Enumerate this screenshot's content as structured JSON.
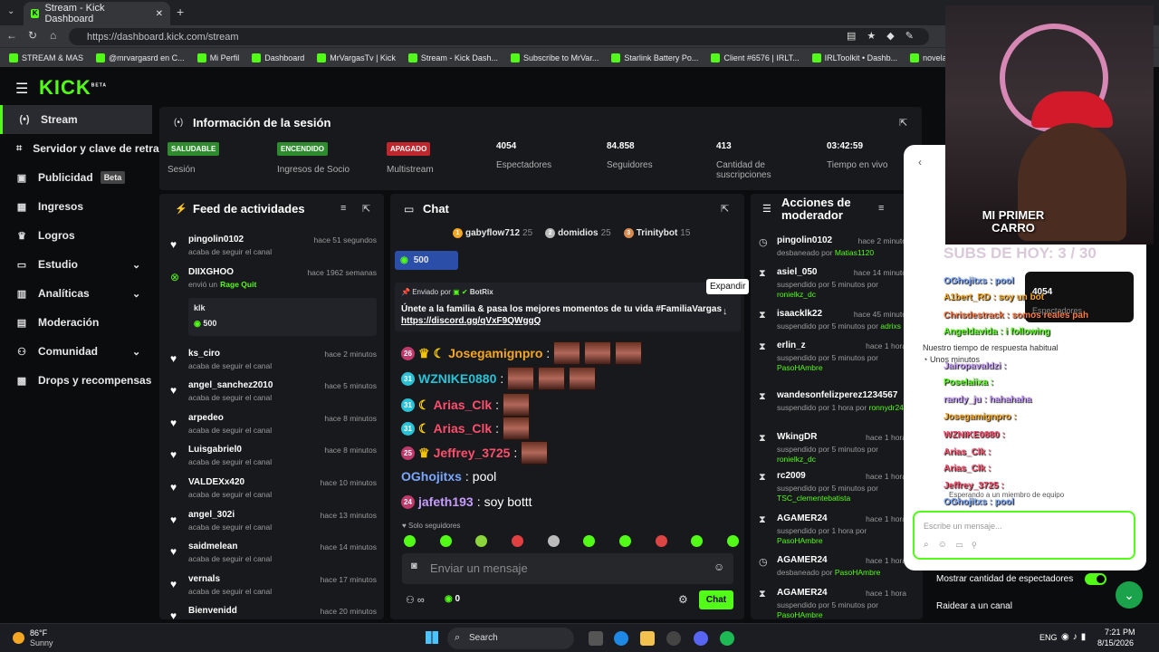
{
  "browser": {
    "tab_title": "Stream - Kick Dashboard",
    "url": "https://dashboard.kick.com/stream",
    "bookmarks": [
      "STREAM & MAS",
      "@mrvargasrd en C...",
      "Mi Perfil",
      "Dashboard",
      "MrVargasTv | Kick",
      "Stream - Kick Dash...",
      "Subscribe to MrVar...",
      "Starlink Battery Po...",
      "Client #6576 | IRLT...",
      "IRLToolkit • Dashb...",
      "novela frutas",
      "Cu"
    ]
  },
  "sidebar": {
    "logo": "KICK",
    "logo_beta": "BETA",
    "items": [
      {
        "label": "Stream"
      },
      {
        "label": "Servidor y clave de retran"
      },
      {
        "label": "Publicidad",
        "badge": "Beta"
      },
      {
        "label": "Ingresos"
      },
      {
        "label": "Logros"
      },
      {
        "label": "Estudio"
      },
      {
        "label": "Analíticas"
      },
      {
        "label": "Moderación"
      },
      {
        "label": "Comunidad"
      },
      {
        "label": "Drops y recompensas"
      }
    ]
  },
  "session": {
    "title": "Información de la sesión",
    "stats": [
      {
        "value": "SALUDABLE",
        "label": "Sesión",
        "color": "#2e8b2e"
      },
      {
        "value": "ENCENDIDO",
        "label": "Ingresos de Socio",
        "color": "#2e8b2e"
      },
      {
        "value": "APAGADO",
        "label": "Multistream",
        "color": "#c0262c"
      },
      {
        "value": "4054",
        "label": "Espectadores"
      },
      {
        "value": "84.858",
        "label": "Seguidores"
      },
      {
        "value": "413",
        "label": "Cantidad de suscripciones"
      },
      {
        "value": "03:42:59",
        "label": "Tiempo en vivo"
      }
    ]
  },
  "feed": {
    "title": "Feed de actividades",
    "items": [
      {
        "user": "pingolin0102",
        "desc": "acaba de seguir el canal",
        "time": "hace 51 segundos"
      },
      {
        "user": "DIIXGHOO",
        "desc": "envió un",
        "gift": "Rage Quit",
        "time": "hace 1962 semanas",
        "card_user": "klk",
        "card_amount": "500"
      },
      {
        "user": "ks_ciro",
        "desc": "acaba de seguir el canal",
        "time": "hace 2 minutos"
      },
      {
        "user": "angel_sanchez2010",
        "desc": "acaba de seguir el canal",
        "time": "hace 5 minutos"
      },
      {
        "user": "arpedeo",
        "desc": "acaba de seguir el canal",
        "time": "hace 8 minutos"
      },
      {
        "user": "Luisgabriel0",
        "desc": "acaba de seguir el canal",
        "time": "hace 8 minutos"
      },
      {
        "user": "VALDEXx420",
        "desc": "acaba de seguir el canal",
        "time": "hace 10 minutos"
      },
      {
        "user": "angel_302i",
        "desc": "acaba de seguir el canal",
        "time": "hace 13 minutos"
      },
      {
        "user": "saidmelean",
        "desc": "acaba de seguir el canal",
        "time": "hace 14 minutos"
      },
      {
        "user": "vernals",
        "desc": "acaba de seguir el canal",
        "time": "hace 17 minutos"
      },
      {
        "user": "Bienvenidd",
        "desc": "",
        "time": "hace 20 minutos"
      }
    ]
  },
  "chat": {
    "title": "Chat",
    "top_gifters": [
      {
        "name": "gabyflow712",
        "n": "25"
      },
      {
        "name": "domidios",
        "n": "25"
      },
      {
        "name": "Trinitybot",
        "n": "15"
      }
    ],
    "pinned_kicks": "500",
    "expand_tooltip": "Expandir",
    "pinned": {
      "sent_by": "Enviado por",
      "bot": "BotRix",
      "text": "Únete a la familia & pasa los mejores momentos de tu vida #FamiliaVargas",
      "link": "https://discord.gg/qVxF9QWggQ"
    },
    "messages": [
      {
        "lvl": "26",
        "user": "Josegamignpro",
        "color": "#f5a623"
      },
      {
        "lvl": "31",
        "user": "WZNIKE0880",
        "color": "#29c2d6"
      },
      {
        "lvl": "31",
        "user": "Arias_Clk",
        "color": "#ff4f6d"
      },
      {
        "lvl": "31",
        "user": "Arias_Clk",
        "color": "#ff4f6d"
      },
      {
        "lvl": "25",
        "user": "Jeffrey_3725",
        "color": "#ff4f6d"
      },
      {
        "user": "OGhojitxs",
        "text": "pool",
        "color": "#7aa7ff"
      },
      {
        "lvl": "24",
        "user": "jafeth193",
        "text": "soy bottt",
        "color": "#c79cff"
      }
    ],
    "followers_only": "Solo seguidores",
    "input_placeholder": "Enviar un mensaje",
    "count": "0",
    "send_label": "Chat"
  },
  "mod": {
    "title": "Acciones de moderador",
    "items": [
      {
        "user": "pingolin0102",
        "desc": "desbaneado por",
        "by": "Matias1120",
        "time": "hace 2 minuto"
      },
      {
        "user": "asiel_050",
        "desc": "suspendido por 5 minutos por",
        "by": "ronielkz_dc",
        "time": "hace 14 minuto"
      },
      {
        "user": "isaacklk22",
        "desc": "suspendido por 5 minutos por",
        "by": "adrixs",
        "time": "hace 45 minuto"
      },
      {
        "user": "erlin_z",
        "desc": "suspendido por 5 minutos por",
        "by": "PasoHAmbre",
        "time": "hace 1 hora"
      },
      {
        "user": "wandesonfelizperez1234567",
        "desc": "suspendido por 1 hora por",
        "by": "ronnydr24",
        "time": ""
      },
      {
        "user": "WkingDR",
        "desc": "suspendido por 5 minutos por",
        "by": "ronielkz_dc",
        "time": "hace 1 hora"
      },
      {
        "user": "rc2009",
        "desc": "suspendido por 5 minutos por",
        "by": "TSC_clementebatista",
        "time": "hace 1 hora"
      },
      {
        "user": "AGAMER24",
        "desc": "suspendido por 1 hora por",
        "by": "PasoHAmbre",
        "time": "hace 1 hora"
      },
      {
        "user": "AGAMER24",
        "desc": "desbaneado por",
        "by": "PasoHAmbre",
        "time": "hace 1 hora"
      },
      {
        "user": "AGAMER24",
        "desc": "suspendido por 5 minutos por",
        "by": "PasoHAmbre",
        "time": "hace 1 hora"
      }
    ]
  },
  "settings": {
    "show_viewers": "Mostrar cantidad de espectadores",
    "raid": "Raidear a un canal"
  },
  "overlay": {
    "banner": "MI PRIMER CARRO",
    "subs": "SUBS DE HOY: 3 / 30",
    "box_value": "4054",
    "box_label": "Espectadores",
    "support_text": "Nuestro tiempo de respuesta habitual",
    "support_time": "Unos minutos",
    "waiting": "Esperando a un miembro de equipo",
    "write_placeholder": "Escribe un mensaje...",
    "lines": [
      {
        "t": "OGhojitxs : pool",
        "c": "#7aa7ff"
      },
      {
        "t": "A1bert_RD : soy un bot",
        "c": "#f5a623"
      },
      {
        "t": "Chrisdestrack : somos reales pah",
        "c": "#ff7a45"
      },
      {
        "t": "Angeldavida : i following",
        "c": "#53fc18"
      },
      {
        "t": "Jairopavaldzi :",
        "c": "#c79cff"
      },
      {
        "t": "Poselaiixa :",
        "c": "#53fc18"
      },
      {
        "t": "randy_ju : hahahaha",
        "c": "#c79cff"
      },
      {
        "t": "Josegamignpro :",
        "c": "#f5a623"
      },
      {
        "t": "WZNIKE0880 :",
        "c": "#ff4f6d"
      },
      {
        "t": "Arias_Clk :",
        "c": "#ff4f6d"
      },
      {
        "t": "Arias_Clk :",
        "c": "#ff4f6d"
      },
      {
        "t": "Jeffrey_3725 :",
        "c": "#ff4f6d"
      },
      {
        "t": "OGhojitxs : pool",
        "c": "#7aa7ff"
      },
      {
        "t": "jafeth193 : soy bott",
        "c": "#c79cff"
      }
    ]
  },
  "taskbar": {
    "weather_temp": "86°F",
    "weather_desc": "Sunny",
    "search": "Search",
    "lang": "ENG",
    "time": "7:21 PM",
    "date": "8/15/2026"
  }
}
